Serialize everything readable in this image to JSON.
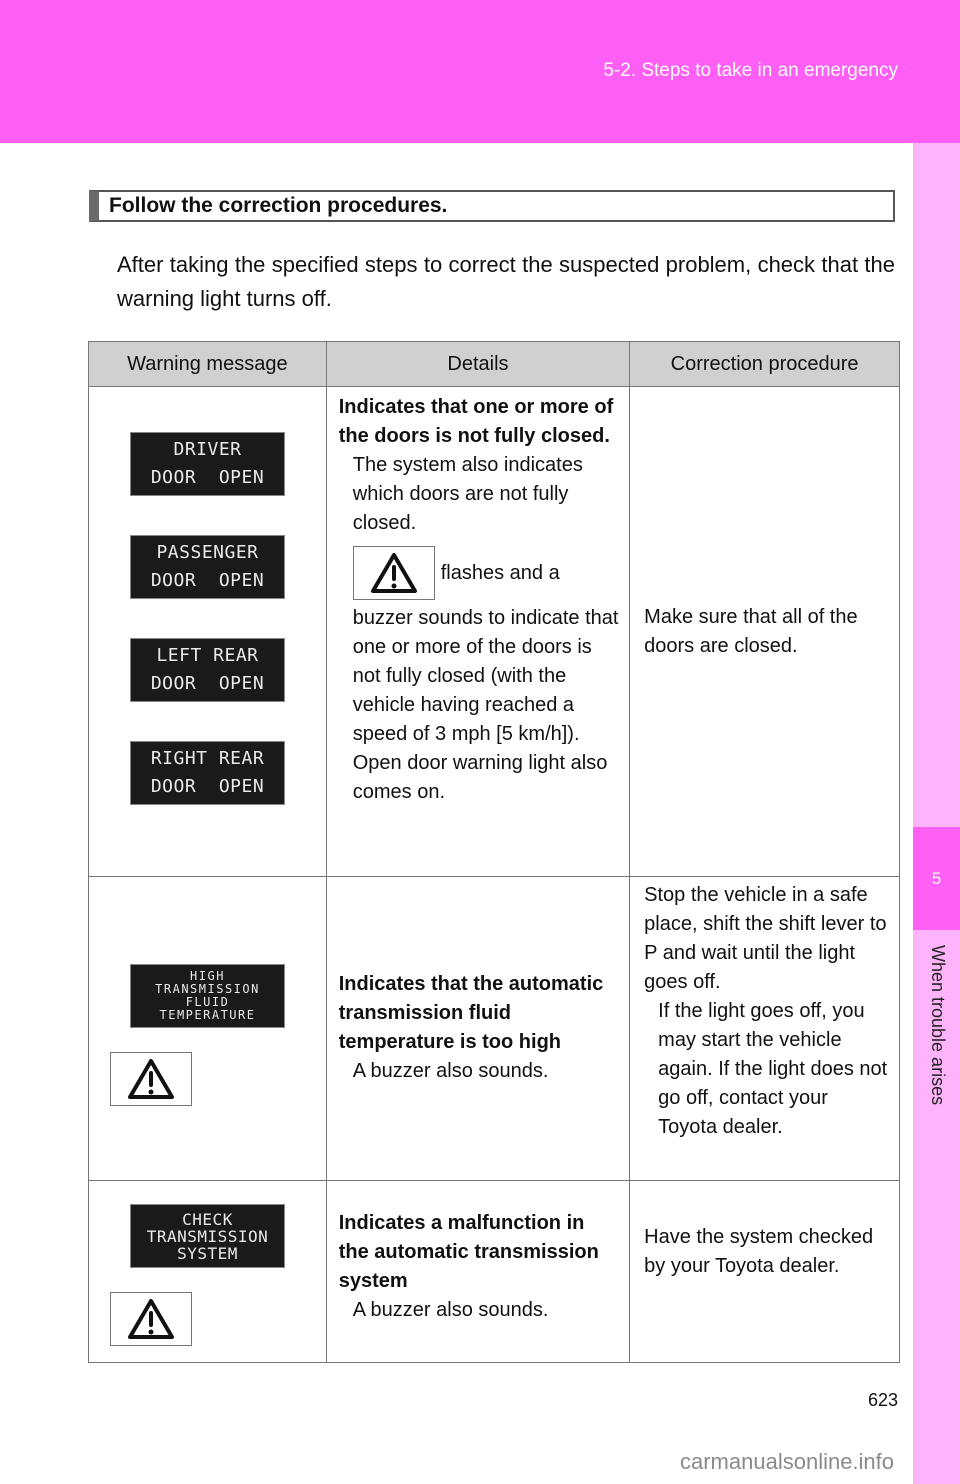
{
  "header": {
    "title": "5-2. Steps to take in an emergency"
  },
  "side_tab": {
    "chapter": "5",
    "label": "When trouble arises"
  },
  "section": {
    "heading": "Follow the correction procedures.",
    "intro": "After taking the specified steps to correct the suspected problem, check that the warning light turns off."
  },
  "table": {
    "headers": [
      "Warning message",
      "Details",
      "Correction procedure"
    ],
    "rows": [
      {
        "messages": [
          [
            "DRIVER",
            "DOOR  OPEN"
          ],
          [
            "PASSENGER",
            "DOOR  OPEN"
          ],
          [
            "LEFT REAR",
            "DOOR  OPEN"
          ],
          [
            "RIGHT REAR",
            "DOOR  OPEN"
          ]
        ],
        "details_bold": "Indicates that one or more of the doors is not fully closed.",
        "details_1": "The system also indicates which doors are not fully closed.",
        "details_icon_text": "flashes and a",
        "details_2": "buzzer sounds to indicate that one or more of the doors is not fully closed (with the vehicle having reached a speed of 3 mph [5 km/h]).",
        "details_3": "Open door warning light also comes on.",
        "correction": "Make sure that all of the doors are closed."
      },
      {
        "messages": [
          [
            "HIGH",
            "TRANSMISSION",
            "FLUID",
            "TEMPERATURE"
          ]
        ],
        "icon": "warning-triangle-icon",
        "details_bold": "Indicates that the automatic transmission fluid temperature is too high",
        "details_1": "A buzzer also sounds.",
        "correction": "Stop the vehicle in a safe place, shift the shift lever to P and wait until the light goes off.",
        "correction_2": "If the light goes off, you may start the vehicle again. If the light does not go off, contact your Toyota dealer."
      },
      {
        "messages": [
          [
            "CHECK",
            "TRANSMISSION",
            "SYSTEM"
          ]
        ],
        "icon": "warning-triangle-icon",
        "details_bold": "Indicates a malfunction in the automatic transmission system",
        "details_1": "A buzzer also sounds.",
        "correction": "Have the system checked by your Toyota dealer."
      }
    ]
  },
  "footer": {
    "page_number": "623",
    "watermark": "carmanualsonline.info"
  },
  "colors": {
    "header": "#ff5ff5",
    "side_tab": "#ffb3fb",
    "table_header": "#d0d0d0"
  }
}
